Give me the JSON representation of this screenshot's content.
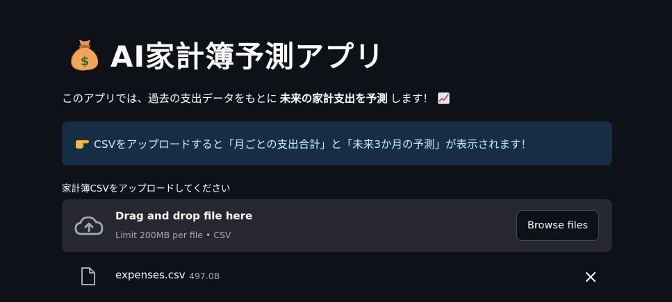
{
  "header": {
    "title": "AI家計簿予測アプリ",
    "title_icon": "money-bag-icon"
  },
  "intro": {
    "before": "このアプリでは、過去の支出データをもとに",
    "bold": "未来の家計支出を予測",
    "after": "します！",
    "icon": "chart-increasing-icon"
  },
  "info": {
    "icon": "backhand-index-pointing-right-icon",
    "text": "CSVをアップロードすると「月ごとの支出合計」と「未来3か月の予測」が表示されます！",
    "background": "#172d43",
    "text_color": "#c7ebff"
  },
  "uploader": {
    "label": "家計簿CSVをアップロードしてください",
    "drop_title": "Drag and drop file here",
    "drop_subtitle": "Limit 200MB per file • CSV",
    "browse_label": "Browse files",
    "icon": "cloud-upload-icon"
  },
  "file": {
    "name": "expenses.csv",
    "size": "497.0B",
    "icon": "file-icon",
    "remove_icon": "close-icon"
  },
  "colors": {
    "background": "#0e1117",
    "dropzone": "#262730",
    "muted_text": "#a3a8b8"
  }
}
